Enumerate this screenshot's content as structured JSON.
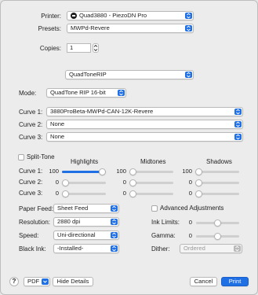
{
  "printer": {
    "label": "Printer:",
    "value": "Quad3880 - PiezoDN Pro"
  },
  "presets": {
    "label": "Presets:",
    "value": "MWPd-Revere"
  },
  "copies": {
    "label": "Copies:",
    "value": "1"
  },
  "panel": {
    "value": "QuadToneRIP"
  },
  "mode": {
    "label": "Mode:",
    "value": "QuadTone RIP 16-bit"
  },
  "curves": [
    {
      "label": "Curve 1:",
      "value": "3880ProBeta-MWPd-CAN-12K-Revere"
    },
    {
      "label": "Curve 2:",
      "value": "None"
    },
    {
      "label": "Curve 3:",
      "value": "None"
    }
  ],
  "split_tone": {
    "label": "Split-Tone",
    "checked": false,
    "headers": {
      "highlights": "Highlights",
      "midtones": "Midtones",
      "shadows": "Shadows"
    },
    "rows": [
      {
        "label": "Curve 1:",
        "highlights": "100",
        "midtones": "100",
        "shadows": "100",
        "h_level": 1.0,
        "m_level": 0.0,
        "s_level": 0.0
      },
      {
        "label": "Curve 2:",
        "highlights": "0",
        "midtones": "0",
        "shadows": "0",
        "h_level": 0.0,
        "m_level": 0.0,
        "s_level": 0.0
      },
      {
        "label": "Curve 3:",
        "highlights": "0",
        "midtones": "0",
        "shadows": "0",
        "h_level": 0.0,
        "m_level": 0.0,
        "s_level": 0.0
      }
    ]
  },
  "paper_feed": {
    "label": "Paper Feed:",
    "value": "Sheet Feed"
  },
  "resolution": {
    "label": "Resolution:",
    "value": "2880 dpi"
  },
  "speed": {
    "label": "Speed:",
    "value": "Uni-directional"
  },
  "black_ink": {
    "label": "Black Ink:",
    "value": "-Installed-"
  },
  "advanced": {
    "label": "Advanced Adjustments",
    "checked": false
  },
  "ink_limits": {
    "label": "Ink Limits:",
    "value": "0",
    "level": 0.5
  },
  "gamma": {
    "label": "Gamma:",
    "value": "0",
    "level": 0.5
  },
  "dither": {
    "label": "Dither:",
    "value": "Ordered"
  },
  "footer": {
    "help": "?",
    "pdf": "PDF",
    "hide_details": "Hide Details",
    "cancel": "Cancel",
    "print": "Print"
  },
  "colors": {
    "accent": "#1f6fe5",
    "window": "#ececec"
  }
}
